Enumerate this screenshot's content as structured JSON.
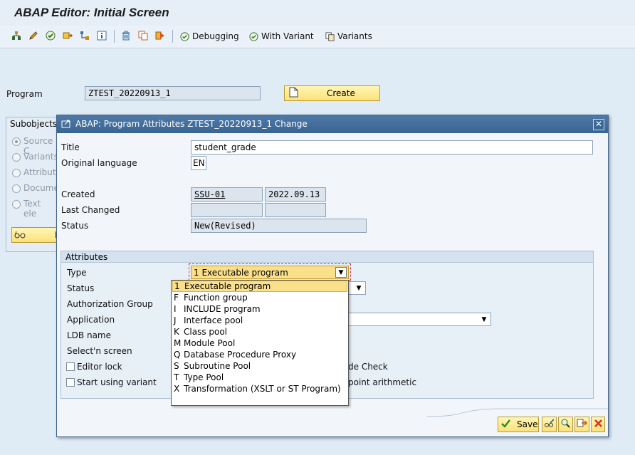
{
  "app": {
    "title": "ABAP Editor: Initial Screen"
  },
  "toolbar": {
    "debugging_label": "Debugging",
    "with_variant_label": "With Variant",
    "variants_label": "Variants"
  },
  "main": {
    "program_label": "Program",
    "program_value": "ZTEST_20220913_1",
    "create_label": "Create",
    "subobjects_label": "Subobjects",
    "subobject_items": [
      "Source C",
      "Variants",
      "Attribute",
      "Documen",
      "Text ele"
    ],
    "display_label": "D"
  },
  "dialog": {
    "title": "ABAP: Program Attributes ZTEST_20220913_1 Change",
    "title_label": "Title",
    "title_value": "student_grade",
    "orig_lang_label": "Original language",
    "orig_lang_value": "EN",
    "created_label": "Created",
    "created_by": "SSU-01",
    "created_date": "2022.09.13",
    "last_changed_label": "Last Changed",
    "status_label": "Status",
    "status_value": "New(Revised)",
    "attributes_header": "Attributes",
    "type_label": "Type",
    "type_value": "1 Executable program",
    "attr_status_label": "Status",
    "auth_group_label": "Authorization Group",
    "application_label": "Application",
    "ldb_label": "LDB name",
    "selscreen_label": "Select'n screen",
    "editor_lock_label": "Editor lock",
    "start_variant_label": "Start using variant",
    "unicode_check_label": "de Check",
    "fixed_point_label": "point arithmetic",
    "save_label": "Save"
  },
  "dropdown": {
    "items": [
      {
        "code": "1",
        "label": "Executable program",
        "selected": true
      },
      {
        "code": "F",
        "label": "Function group",
        "selected": false
      },
      {
        "code": "I",
        "label": "INCLUDE program",
        "selected": false
      },
      {
        "code": "J",
        "label": "Interface pool",
        "selected": false
      },
      {
        "code": "K",
        "label": "Class pool",
        "selected": false
      },
      {
        "code": "M",
        "label": "Module Pool",
        "selected": false
      },
      {
        "code": "Q",
        "label": "Database Procedure Proxy",
        "selected": false
      },
      {
        "code": "S",
        "label": "Subroutine Pool",
        "selected": false
      },
      {
        "code": "T",
        "label": "Type Pool",
        "selected": false
      },
      {
        "code": "X",
        "label": "Transformation (XSLT or ST Program)",
        "selected": false
      }
    ]
  },
  "colors": {
    "dialog_title_bg": "#3a6593",
    "button_yellow": "#fbe17a",
    "selected_item": "#fbe08c"
  }
}
